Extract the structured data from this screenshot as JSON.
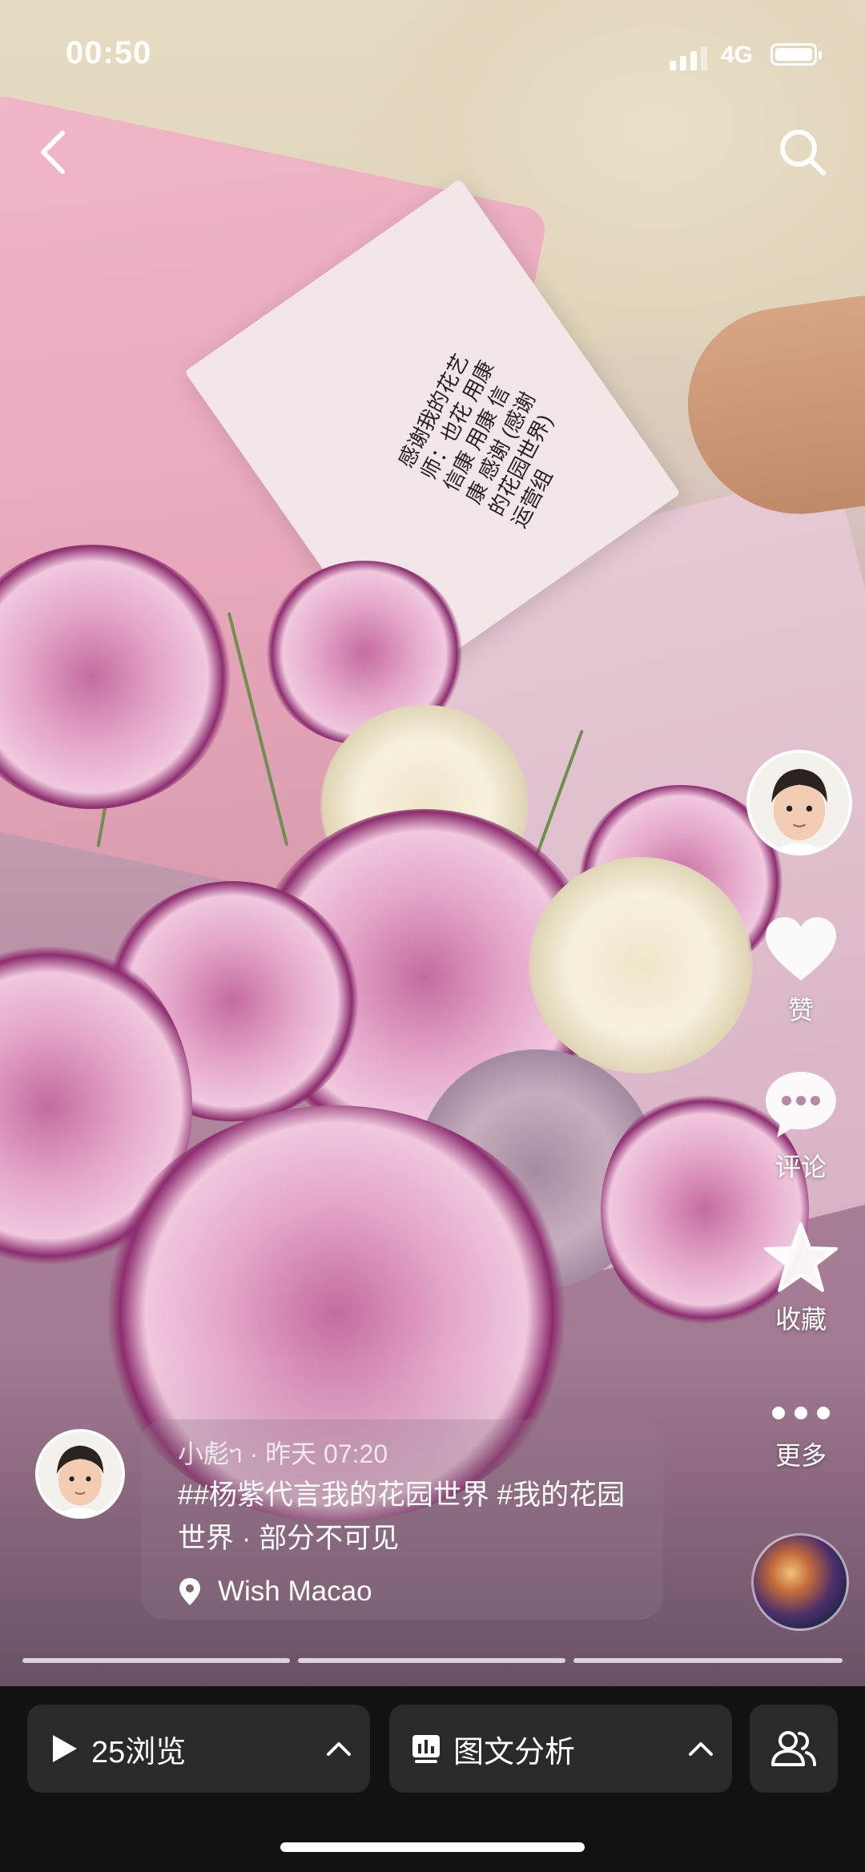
{
  "status_bar": {
    "time": "00:50",
    "network": "4G"
  },
  "top_bar": {
    "back_icon": "chevron-left-icon",
    "search_icon": "search-icon"
  },
  "photo": {
    "card_text": "感谢我的花艺师：也花 用康 信康 用康 信康 感谢 (感谢的花园世界) 运营组"
  },
  "actions": {
    "like_label": "赞",
    "comment_label": "评论",
    "collect_label": "收藏",
    "more_label": "更多"
  },
  "post": {
    "author": "小彪ᥐ",
    "separator": "·",
    "time": "昨天 07:20",
    "caption": "##杨紫代言我的花园世界 #我的花园世界 · 部分不可见",
    "location": "Wish Macao"
  },
  "story_progress": {
    "segments": 3
  },
  "bottom_bar": {
    "views_label": "25浏览",
    "analysis_label": "图文分析"
  },
  "colors": {
    "bottom_bg": "#121212",
    "button_bg": "#2a2a2a",
    "text": "#ffffff"
  }
}
